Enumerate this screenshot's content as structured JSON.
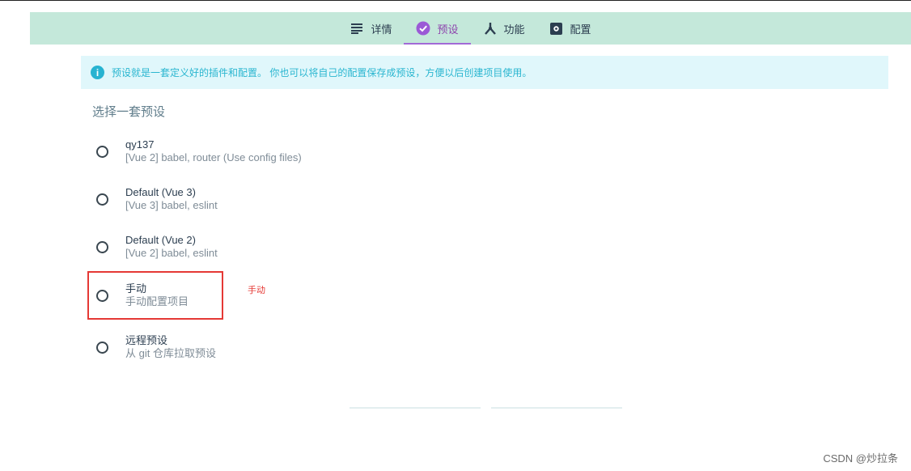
{
  "tabs": [
    {
      "label": "详情",
      "icon": "list-icon"
    },
    {
      "label": "预设",
      "icon": "check-circle-icon"
    },
    {
      "label": "功能",
      "icon": "merge-icon"
    },
    {
      "label": "配置",
      "icon": "settings-box-icon"
    }
  ],
  "active_tab": "预设",
  "info": {
    "text": "预设就是一套定义好的插件和配置。 你也可以将自己的配置保存成预设，方便以后创建项目使用。",
    "icon": "info-icon"
  },
  "section_title": "选择一套预设",
  "presets": [
    {
      "name": "qy137",
      "desc": "[Vue 2] babel, router (Use config files)"
    },
    {
      "name": "Default (Vue 3)",
      "desc": "[Vue 3] babel, eslint"
    },
    {
      "name": "Default (Vue 2)",
      "desc": "[Vue 2] babel, eslint"
    },
    {
      "name": "手动",
      "desc": "手动配置项目"
    },
    {
      "name": "远程预设",
      "desc": "从 git 仓库拉取预设"
    }
  ],
  "annotation": "手动",
  "watermark": "CSDN @炒拉条",
  "colors": {
    "tabbar_bg": "#c4e8da",
    "active_tab": "#8e44ad",
    "info_bg": "#e0f7fb",
    "info_text": "#2ab6d0",
    "highlight": "#e53935"
  }
}
